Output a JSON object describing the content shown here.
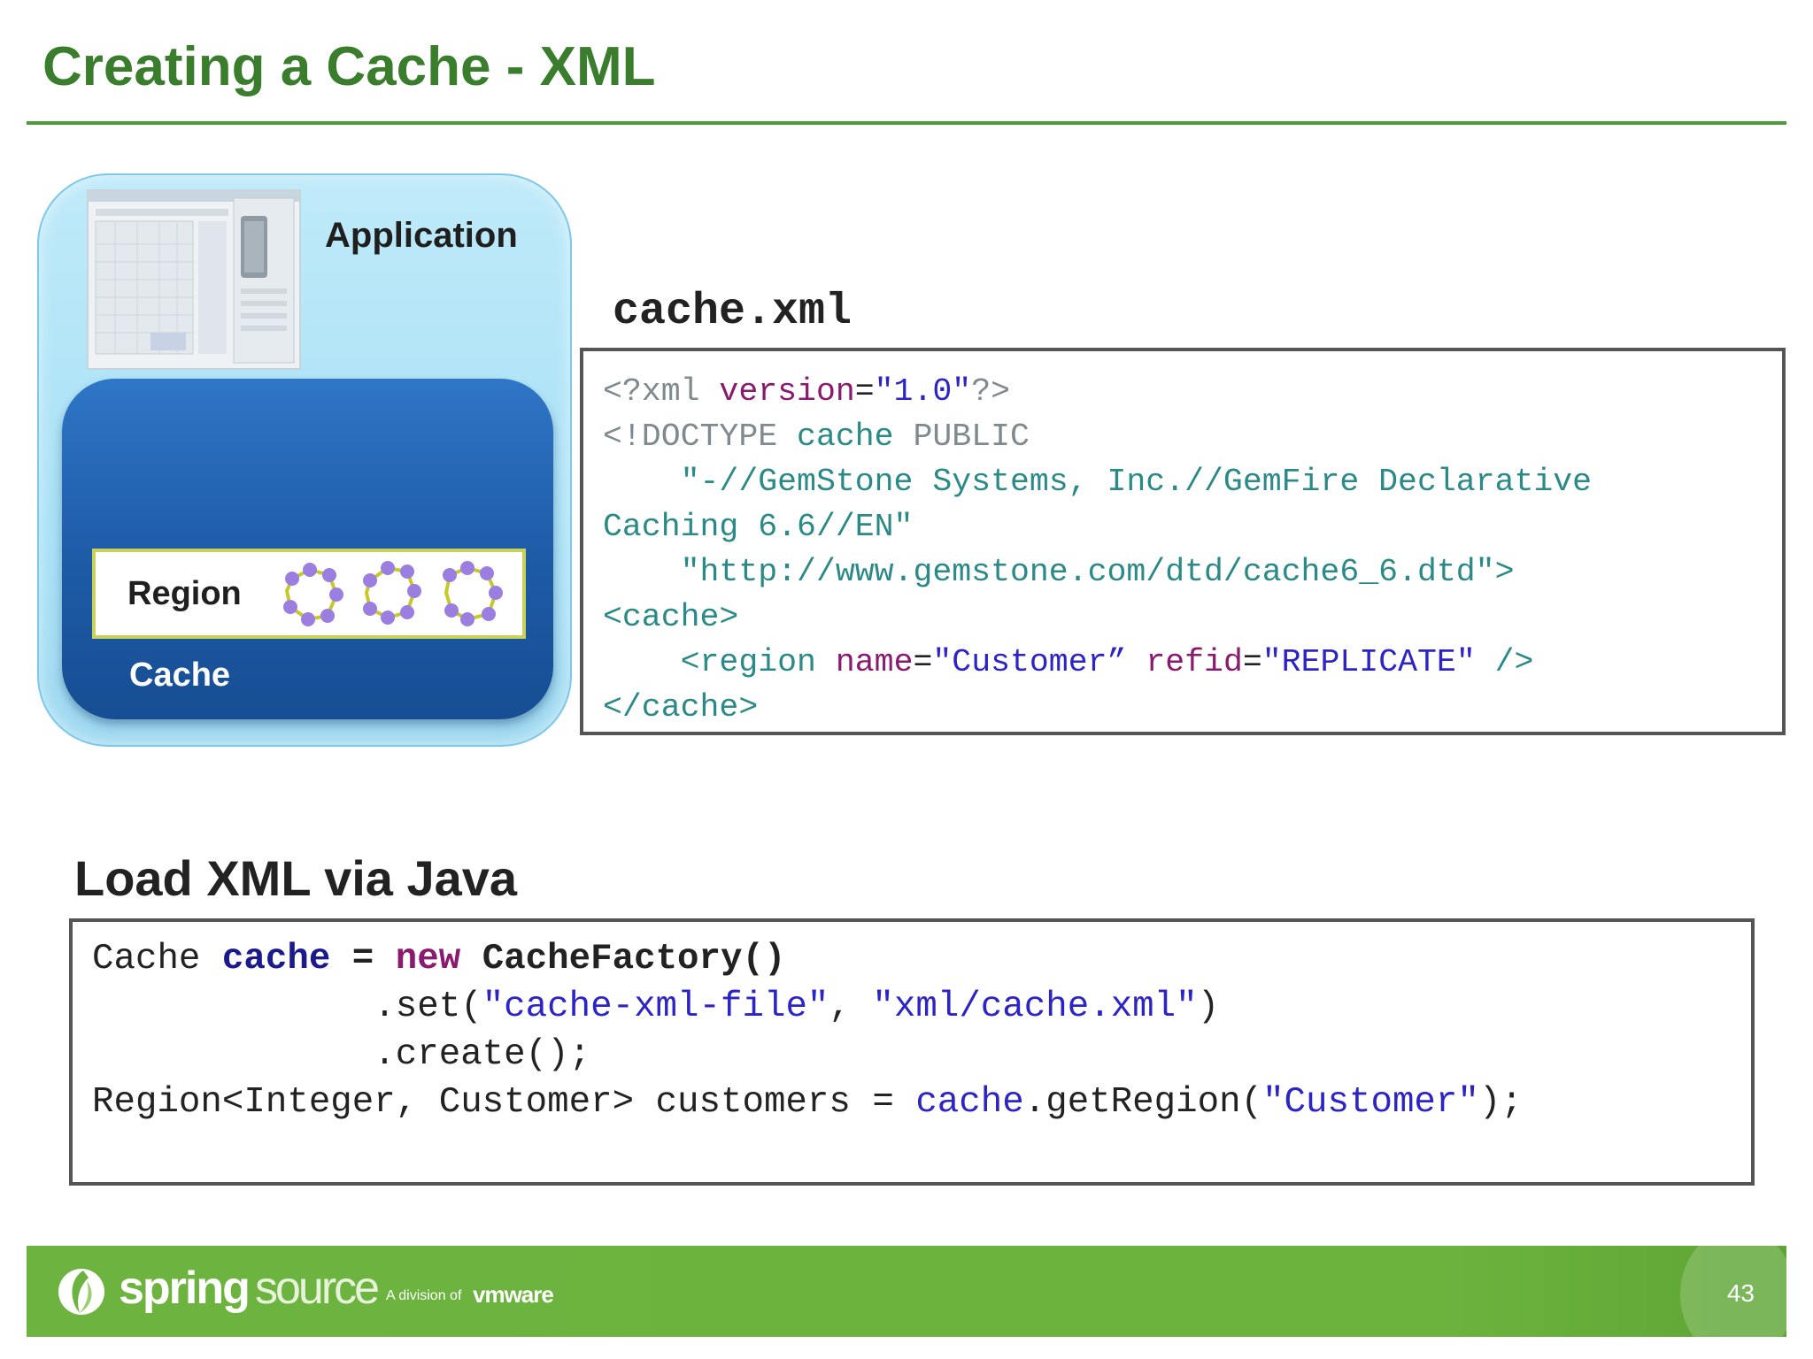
{
  "slide": {
    "title": "Creating a Cache - XML",
    "page_number": "43"
  },
  "diagram": {
    "application_label": "Application",
    "region_label": "Region",
    "cache_label": "Cache"
  },
  "xml": {
    "heading": "cache.xml",
    "line1": {
      "open": "<?xml ",
      "attr": "version",
      "eq": "=",
      "val": "\"1.0\"",
      "close": "?>"
    },
    "line2": {
      "open": "<!DOCTYPE ",
      "name": "cache ",
      "public": "PUBLIC"
    },
    "line3": {
      "text": "    \"-//GemStone Systems, Inc.//GemFire Declarative"
    },
    "line4": {
      "text": "Caching 6.6//EN\""
    },
    "line5": {
      "text": "    \"http://www.gemstone.com/dtd/cache6_6.dtd\">"
    },
    "line6": {
      "text": "<cache>"
    },
    "line7": {
      "indent": "    ",
      "open": "<region ",
      "attr1": "name",
      "eq1": "=",
      "val1": "\"Customer”",
      "sp": " ",
      "attr2": "refid",
      "eq2": "=",
      "val2": "\"REPLICATE\"",
      "close": " />"
    },
    "line8": {
      "text": "</cache>"
    }
  },
  "java": {
    "heading": "Load XML via Java",
    "line1": {
      "type": "Cache ",
      "var": "cache",
      "eq": " = ",
      "kw": "new",
      "sp": " ",
      "cls": "CacheFactory()"
    },
    "line2": {
      "indent": "             ",
      "method": ".set(",
      "arg1": "\"cache-xml-file\"",
      "comma": ", ",
      "arg2": "\"xml/cache.xml\"",
      "close": ")"
    },
    "line3": {
      "text": "             .create();"
    },
    "line4": {
      "decl": "Region<Integer, Customer> customers = ",
      "obj": "cache",
      "method": ".getRegion(",
      "arg": "\"Customer\"",
      "close": ");"
    }
  },
  "footer": {
    "brand_spring": "spring",
    "brand_source": "source",
    "division": "A division of",
    "vmware": "vmware"
  },
  "colors": {
    "title_green": "#3a7d2c",
    "footer_green": "#6db33f",
    "cache_blue": "#1d5aa6",
    "application_bg": "#a9e1f6",
    "xml_tag": "#2b8a87",
    "xml_attr": "#8a1a6f",
    "xml_value": "#2c24c4"
  }
}
